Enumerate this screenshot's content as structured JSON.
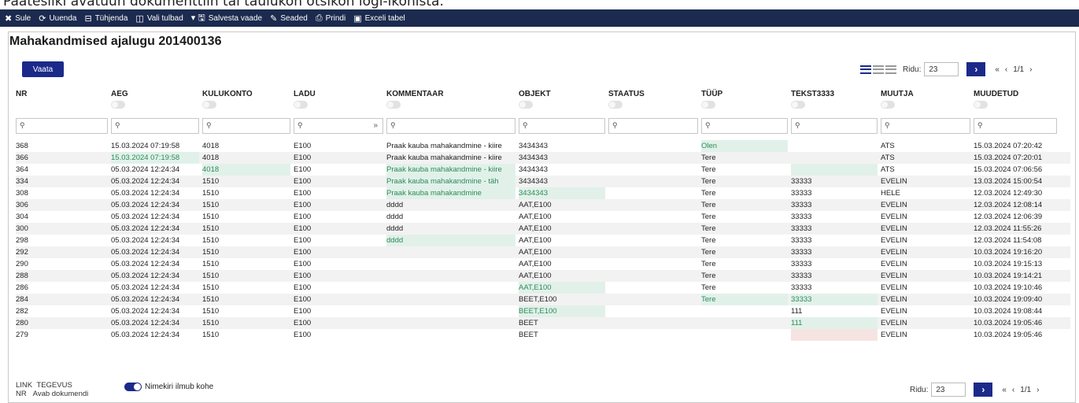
{
  "caption": "Päätesiikl avatuun dokumenttiin tai taulukon otsikon logi-ikonista.",
  "toolbar": [
    {
      "icon": "close-icon",
      "glyph": "✖",
      "label": "Sule"
    },
    {
      "icon": "refresh-icon",
      "glyph": "⟳",
      "label": "Uuenda"
    },
    {
      "icon": "clear-icon",
      "glyph": "⊟",
      "label": "Tühjenda"
    },
    {
      "icon": "columns-icon",
      "glyph": "◫",
      "label": "Vali tulbad"
    },
    {
      "icon": "save-view-icon",
      "glyph": "▾ 🖫",
      "label": "Salvesta vaade"
    },
    {
      "icon": "settings-icon",
      "glyph": "✎",
      "label": "Seaded"
    },
    {
      "icon": "print-icon",
      "glyph": "⎙",
      "label": "Prindi"
    },
    {
      "icon": "excel-icon",
      "glyph": "▣",
      "label": "Exceli tabel"
    }
  ],
  "page_title": "Mahakandmised ajalugu 201400136",
  "vaata_label": "Vaata",
  "pager": {
    "ridu_label": "Ridu:",
    "ridu_value": "23",
    "go_glyph": "›",
    "first": "«",
    "prev": "‹",
    "pages": "1/1",
    "next": "›"
  },
  "columns": [
    "NR",
    "AEG",
    "KULUKONTO",
    "LADU",
    "KOMMENTAAR",
    "OBJEKT",
    "STAATUS",
    "TÜÜP",
    "TEKST3333",
    "MUUTJA",
    "MUUDETUD"
  ],
  "rows": [
    [
      "368",
      "15.03.2024 07:19:58",
      "4018",
      "E100",
      "Praak kauba mahakandmine - kiire",
      "3434343",
      "",
      "Olen",
      "",
      "ATS",
      "15.03.2024 07:20:42"
    ],
    [
      "366",
      "15.03.2024 07:19:58",
      "4018",
      "E100",
      "Praak kauba mahakandmine - kiire",
      "3434343",
      "",
      "Tere",
      "",
      "ATS",
      "15.03.2024 07:20:01"
    ],
    [
      "364",
      "05.03.2024 12:24:34",
      "4018",
      "E100",
      "Praak kauba mahakandmine - kiire",
      "3434343",
      "",
      "Tere",
      "",
      "ATS",
      "15.03.2024 07:06:56"
    ],
    [
      "334",
      "05.03.2024 12:24:34",
      "1510",
      "E100",
      "Praak kauba mahakandmine - täh",
      "3434343",
      "",
      "Tere",
      "33333",
      "EVELIN",
      "13.03.2024 15:00:54"
    ],
    [
      "308",
      "05.03.2024 12:24:34",
      "1510",
      "E100",
      "Praak kauba mahakandmine",
      "3434343",
      "",
      "Tere",
      "33333",
      "HELE",
      "12.03.2024 12:49:30"
    ],
    [
      "306",
      "05.03.2024 12:24:34",
      "1510",
      "E100",
      "dddd",
      "AAT,E100",
      "",
      "Tere",
      "33333",
      "EVELIN",
      "12.03.2024 12:08:14"
    ],
    [
      "304",
      "05.03.2024 12:24:34",
      "1510",
      "E100",
      "dddd",
      "AAT,E100",
      "",
      "Tere",
      "33333",
      "EVELIN",
      "12.03.2024 12:06:39"
    ],
    [
      "300",
      "05.03.2024 12:24:34",
      "1510",
      "E100",
      "dddd",
      "AAT,E100",
      "",
      "Tere",
      "33333",
      "EVELIN",
      "12.03.2024 11:55:26"
    ],
    [
      "298",
      "05.03.2024 12:24:34",
      "1510",
      "E100",
      "dddd",
      "AAT,E100",
      "",
      "Tere",
      "33333",
      "EVELIN",
      "12.03.2024 11:54:08"
    ],
    [
      "292",
      "05.03.2024 12:24:34",
      "1510",
      "E100",
      "",
      "AAT,E100",
      "",
      "Tere",
      "33333",
      "EVELIN",
      "10.03.2024 19:16:20"
    ],
    [
      "290",
      "05.03.2024 12:24:34",
      "1510",
      "E100",
      "",
      "AAT,E100",
      "",
      "Tere",
      "33333",
      "EVELIN",
      "10.03.2024 19:15:13"
    ],
    [
      "288",
      "05.03.2024 12:24:34",
      "1510",
      "E100",
      "",
      "AAT,E100",
      "",
      "Tere",
      "33333",
      "EVELIN",
      "10.03.2024 19:14:21"
    ],
    [
      "286",
      "05.03.2024 12:24:34",
      "1510",
      "E100",
      "",
      "AAT,E100",
      "",
      "Tere",
      "33333",
      "EVELIN",
      "10.03.2024 19:10:46"
    ],
    [
      "284",
      "05.03.2024 12:24:34",
      "1510",
      "E100",
      "",
      "BEET,E100",
      "",
      "Tere",
      "33333",
      "EVELIN",
      "10.03.2024 19:09:40"
    ],
    [
      "282",
      "05.03.2024 12:24:34",
      "1510",
      "E100",
      "",
      "BEET,E100",
      "",
      "",
      "111",
      "EVELIN",
      "10.03.2024 19:08:44"
    ],
    [
      "280",
      "05.03.2024 12:24:34",
      "1510",
      "E100",
      "",
      "BEET",
      "",
      "",
      "111",
      "EVELIN",
      "10.03.2024 19:05:46"
    ],
    [
      "279",
      "05.03.2024 12:24:34",
      "1510",
      "E100",
      "",
      "BEET",
      "",
      "",
      "",
      "EVELIN",
      "10.03.2024 19:05:46"
    ]
  ],
  "highlights": [
    [
      0,
      7
    ],
    [
      1,
      1
    ],
    [
      2,
      2
    ],
    [
      2,
      4
    ],
    [
      2,
      8
    ],
    [
      3,
      4
    ],
    [
      4,
      4
    ],
    [
      4,
      5
    ],
    [
      8,
      4
    ],
    [
      12,
      5
    ],
    [
      13,
      7
    ],
    [
      13,
      8
    ],
    [
      14,
      5
    ],
    [
      15,
      8
    ]
  ],
  "warnings": [
    [
      16,
      8
    ]
  ],
  "footer": {
    "link_label": "LINK",
    "tegevus_label": "TEGEVUS",
    "nr_label": "NR",
    "avab_label": "Avab dokumendi",
    "toggle_label": "Nimekiri ilmub kohe"
  },
  "colors": {
    "toolbar": "#1b2a4e",
    "accent": "#1b2a8a",
    "highlight_bg": "#e1f1ea",
    "highlight_text": "#2e8b57"
  }
}
